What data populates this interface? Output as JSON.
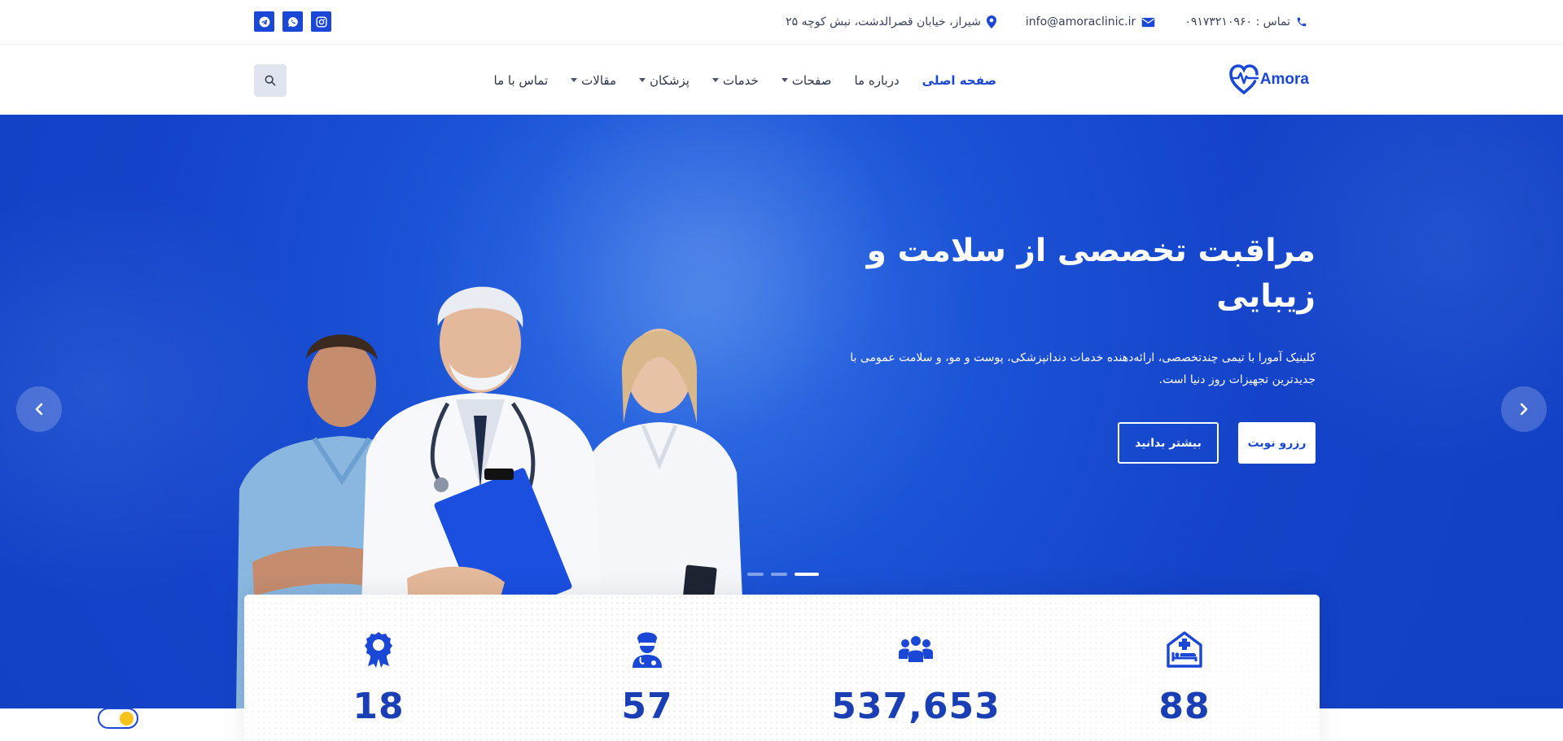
{
  "topbar": {
    "phone": "تماس : ۰۹۱۷۳۲۱۰۹۶۰",
    "email": "info@amoraclinic.ir",
    "address": "شیراز، خیابان قصرالدشت، نبش کوچه ۲۵",
    "social": [
      "telegram-icon",
      "whatsapp-icon",
      "instagram-icon"
    ]
  },
  "brand": {
    "name": "Amora",
    "color": "#1a47d6"
  },
  "nav": {
    "items": [
      {
        "label": "صفحه اصلی",
        "active": true,
        "dropdown": false
      },
      {
        "label": "درباره ما",
        "active": false,
        "dropdown": false
      },
      {
        "label": "صفحات",
        "active": false,
        "dropdown": true
      },
      {
        "label": "خدمات",
        "active": false,
        "dropdown": true
      },
      {
        "label": "پزشکان",
        "active": false,
        "dropdown": true
      },
      {
        "label": "مقالات",
        "active": false,
        "dropdown": true
      },
      {
        "label": "تماس با ما",
        "active": false,
        "dropdown": false
      }
    ]
  },
  "hero": {
    "title": "مراقبت تخصصی از سلامت و زیبایی",
    "description": "کلینیک آمورا با تیمی چندتخصصی، ارائه‌دهنده خدمات دندانپزشکی، پوست و مو، و سلامت عمومی با جدیدترین تجهیزات روز دنیا است.",
    "primary_button": "رزرو نوبت",
    "secondary_button": "بیشتر بدانید",
    "slide_count": 3,
    "active_slide": 3
  },
  "stats": [
    {
      "icon": "award-icon",
      "value": "18"
    },
    {
      "icon": "doctor-icon",
      "value": "57"
    },
    {
      "icon": "users-icon",
      "value": "537,653"
    },
    {
      "icon": "hospital-bed-icon",
      "value": "88"
    }
  ],
  "colors": {
    "primary": "#1a47d6",
    "hero_bg": "#1b52d6",
    "stat_number": "#1a3fb5"
  }
}
